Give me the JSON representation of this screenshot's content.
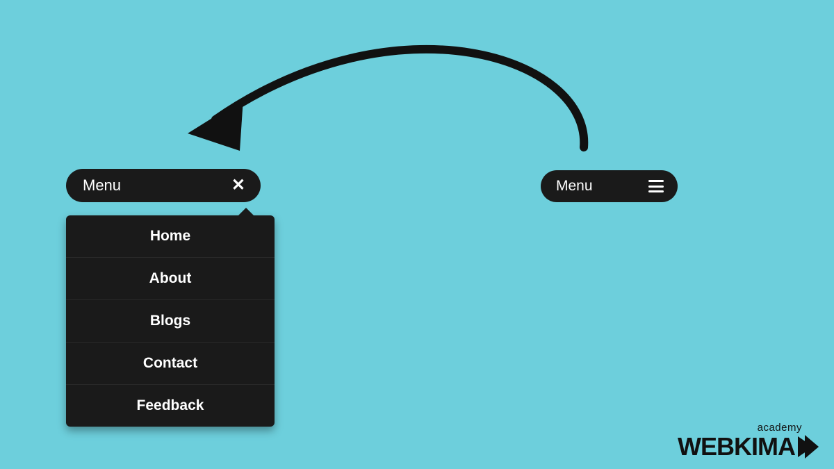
{
  "menu_open": {
    "label": "Menu"
  },
  "menu_closed": {
    "label": "Menu"
  },
  "dropdown": {
    "items": [
      "Home",
      "About",
      "Blogs",
      "Contact",
      "Feedback"
    ]
  },
  "logo": {
    "small": "academy",
    "large": "WEBKIMA"
  }
}
